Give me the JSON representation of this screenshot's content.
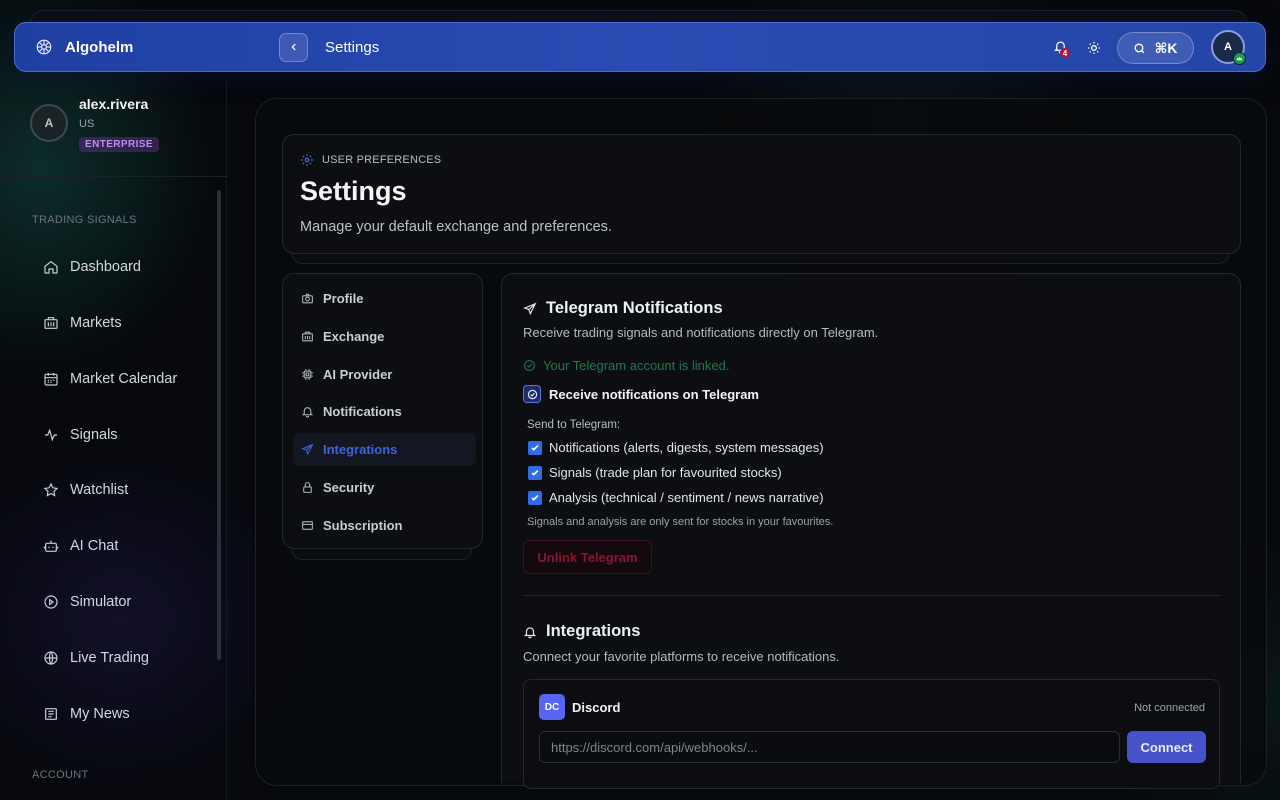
{
  "app": {
    "name": "Algohelm"
  },
  "topbar": {
    "page_title": "Settings",
    "notification_count": "4",
    "search_shortcut": "⌘K",
    "avatar_initial": "A"
  },
  "user": {
    "initial": "A",
    "name": "alex.rivera",
    "country": "US",
    "plan": "ENTERPRISE"
  },
  "sidebar": {
    "section_trading": "TRADING SIGNALS",
    "section_account": "ACCOUNT",
    "items": [
      {
        "label": "Dashboard",
        "icon": "home-icon"
      },
      {
        "label": "Markets",
        "icon": "markets-icon"
      },
      {
        "label": "Market Calendar",
        "icon": "calendar-icon"
      },
      {
        "label": "Signals",
        "icon": "activity-icon"
      },
      {
        "label": "Watchlist",
        "icon": "star-icon"
      },
      {
        "label": "AI Chat",
        "icon": "bot-icon"
      },
      {
        "label": "Simulator",
        "icon": "play-circle-icon"
      },
      {
        "label": "Live Trading",
        "icon": "globe-icon"
      },
      {
        "label": "My News",
        "icon": "newspaper-icon"
      }
    ]
  },
  "header": {
    "eyebrow": "USER PREFERENCES",
    "title": "Settings",
    "subtitle": "Manage your default exchange and preferences."
  },
  "settings_nav": {
    "active": "Integrations",
    "items": [
      {
        "label": "Profile",
        "icon": "camera-icon"
      },
      {
        "label": "Exchange",
        "icon": "bank-icon"
      },
      {
        "label": "AI Provider",
        "icon": "cpu-icon"
      },
      {
        "label": "Notifications",
        "icon": "bell-icon"
      },
      {
        "label": "Integrations",
        "icon": "send-icon"
      },
      {
        "label": "Security",
        "icon": "lock-icon"
      },
      {
        "label": "Subscription",
        "icon": "credit-card-icon"
      }
    ]
  },
  "telegram": {
    "title": "Telegram Notifications",
    "description": "Receive trading signals and notifications directly on Telegram.",
    "linked_status": "Your Telegram account is linked.",
    "receive_label": "Receive notifications on Telegram",
    "send_to_label": "Send to Telegram:",
    "options": [
      {
        "label": "Notifications (alerts, digests, system messages)",
        "checked": true
      },
      {
        "label": "Signals (trade plan for favourited stocks)",
        "checked": true
      },
      {
        "label": "Analysis (technical / sentiment / news narrative)",
        "checked": true
      }
    ],
    "note": "Signals and analysis are only sent for stocks in your favourites.",
    "unlink_label": "Unlink Telegram"
  },
  "integrations": {
    "title": "Integrations",
    "description": "Connect your favorite platforms to receive notifications.",
    "discord": {
      "logo_text": "DC",
      "name": "Discord",
      "status": "Not connected",
      "placeholder": "https://discord.com/api/webhooks/...",
      "value": "",
      "connect_label": "Connect"
    }
  },
  "colors": {
    "accent": "#3f63d9",
    "topbar": "#2446a8",
    "success": "#1f7a4c",
    "danger": "#8b1430",
    "discord": "#5865f2"
  }
}
